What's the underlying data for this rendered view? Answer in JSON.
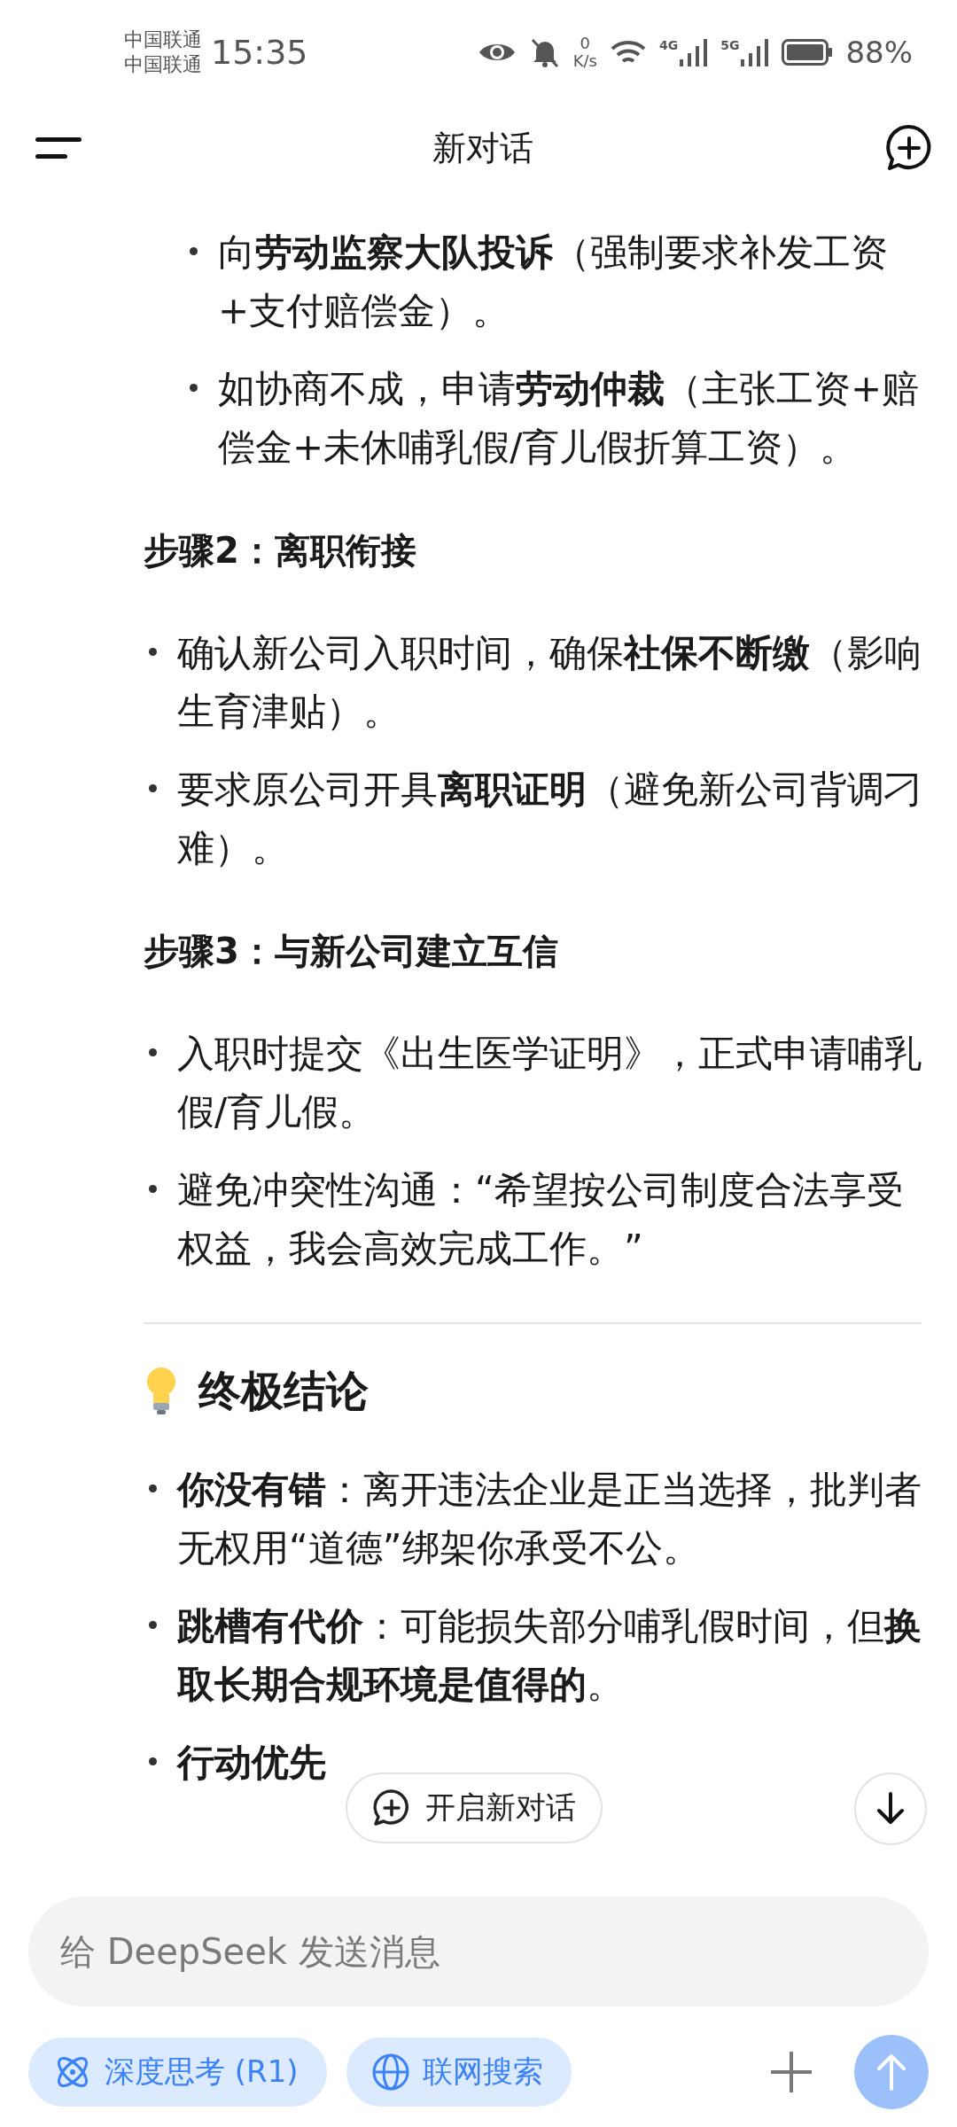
{
  "status_bar": {
    "carriers": [
      "中国联通",
      "中国联通"
    ],
    "time": "15:35",
    "net_speed": {
      "value": "0",
      "unit": "K/s"
    },
    "signals": [
      {
        "label": "4G"
      },
      {
        "label": "5G"
      }
    ],
    "battery_text": "88%"
  },
  "header": {
    "title": "新对话"
  },
  "content": [
    {
      "kind": "sublist",
      "items": [
        "向**劳动监察大队投诉**（强制要求补发工资+支付赔偿金）。",
        "如协商不成，申请**劳动仲裁**（主张工资+赔偿金+未休哺乳假/育儿假折算工资）。"
      ]
    },
    {
      "kind": "heading",
      "text": "步骤2：离职衔接"
    },
    {
      "kind": "list",
      "items": [
        "确认新公司入职时间，确保**社保不断缴**（影响生育津贴）。",
        "要求原公司开具**离职证明**（避免新公司背调刁难）。"
      ]
    },
    {
      "kind": "heading",
      "text": "步骤3：与新公司建立互信"
    },
    {
      "kind": "list",
      "items": [
        "入职时提交《出生医学证明》，正式申请哺乳假/育儿假。",
        "避免冲突性沟通：“希望按公司制度合法享受权益，我会高效完成工作。”"
      ]
    },
    {
      "kind": "divider"
    },
    {
      "kind": "section_title",
      "text": "终极结论"
    },
    {
      "kind": "list",
      "items": [
        "**你没有错**：离开违法企业是正当选择，批判者无权用“道德”绑架你承受不公。",
        "**跳槽有代价**：可能损失部分哺乳假时间，但**换取长期合规环境是值得的**。",
        "**行动优先**"
      ]
    }
  ],
  "floating": {
    "new_chat_label": "开启新对话"
  },
  "composer": {
    "placeholder": "给 DeepSeek 发送消息",
    "chips": [
      {
        "kind": "deep_think",
        "label": "深度思考 (R1)",
        "selected": true
      },
      {
        "kind": "web_search",
        "label": "联网搜索",
        "selected": true
      }
    ],
    "send_disabled": true
  }
}
